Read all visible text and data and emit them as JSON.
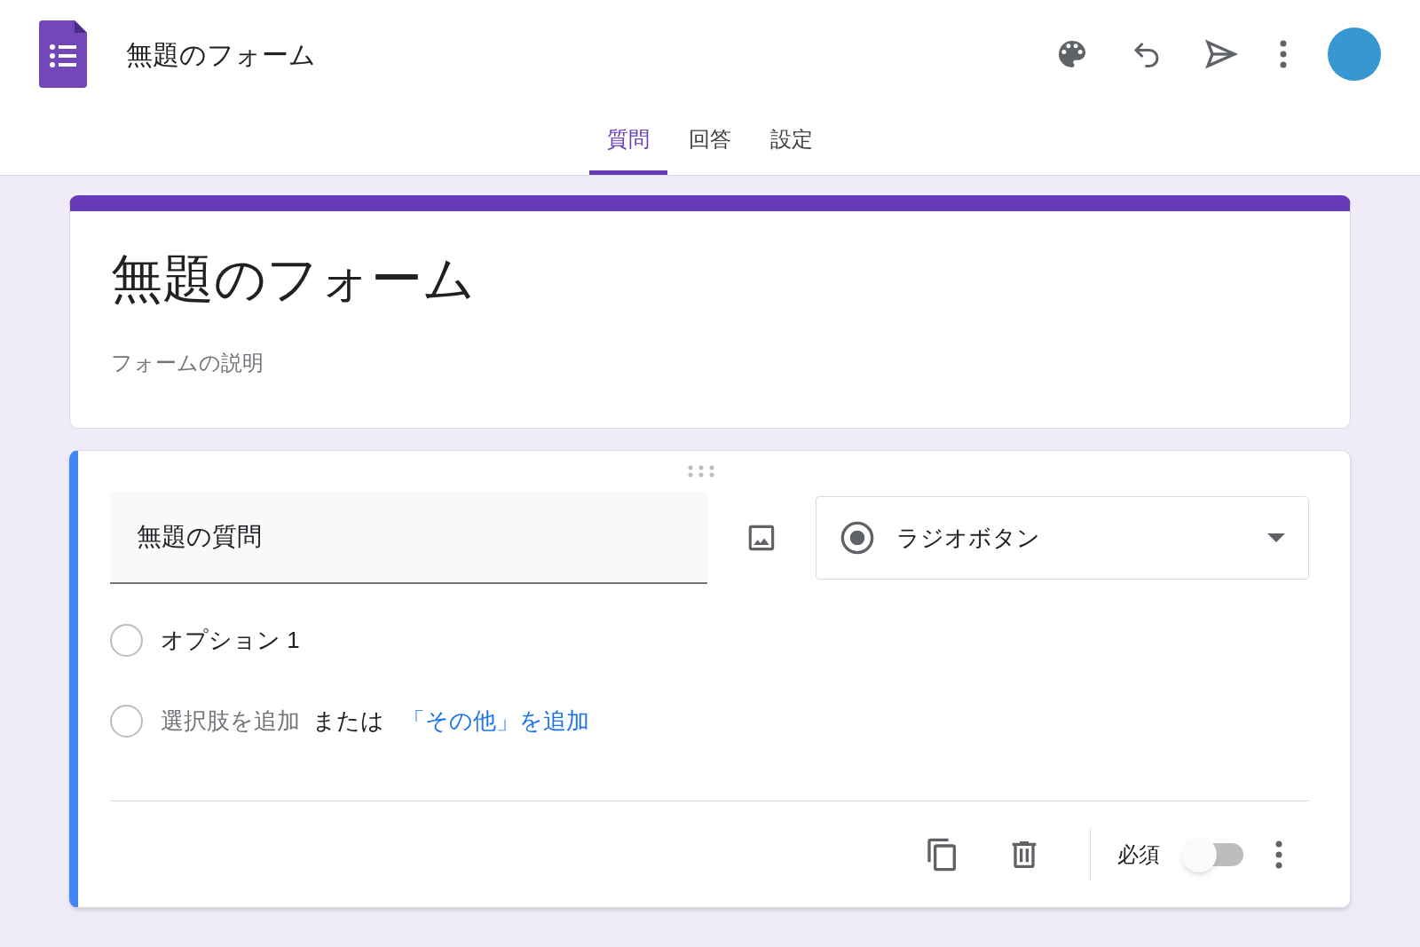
{
  "header": {
    "title": "無題のフォーム"
  },
  "tabs": [
    {
      "label": "質問",
      "selected": true
    },
    {
      "label": "回答",
      "selected": false
    },
    {
      "label": "設定",
      "selected": false
    }
  ],
  "form": {
    "title": "無題のフォーム",
    "description": {
      "placeholder": "フォームの説明"
    }
  },
  "question": {
    "title": "無題の質問",
    "type": "ラジオボタン",
    "options": [
      {
        "label": "オプション 1",
        "selected": false
      }
    ],
    "add_option": {
      "label": "選択肢を追加",
      "selected": false
    },
    "or": "または",
    "add_other": "「その他」を追加",
    "required": {
      "label": "必須",
      "on": false
    }
  }
}
